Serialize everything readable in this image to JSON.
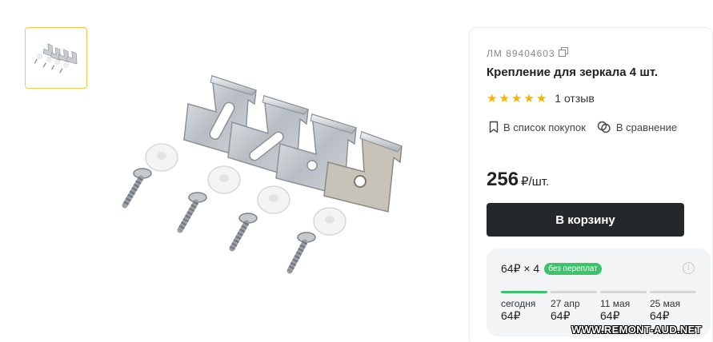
{
  "product": {
    "article": "ЛМ 89404603",
    "title": "Крепление для зеркала 4 шт.",
    "rating": 5,
    "reviews": "1 отзыв",
    "actions": {
      "shopping_list": "В список покупок",
      "compare": "В сравнение"
    },
    "price": "256",
    "price_unit": "₽/шт.",
    "buy_label": "В корзину"
  },
  "installment": {
    "summary": "64₽ × 4",
    "badge": "без переплат",
    "info_icon": "i",
    "steps": [
      {
        "date": "сегодня",
        "amount": "64₽"
      },
      {
        "date": "27 апр",
        "amount": "64₽"
      },
      {
        "date": "11 мая",
        "amount": "64₽"
      },
      {
        "date": "25 мая",
        "amount": "64₽"
      }
    ]
  },
  "watermark": "WWW.REMONT-AUD.NET",
  "colors": {
    "buy_button": "#25282b",
    "badge": "#3cc46b",
    "star": "#f6b600",
    "thumb_border": "#f2c94c"
  },
  "icons": [
    "copy-icon",
    "star-icon",
    "bookmark-icon",
    "compare-icon",
    "info-icon"
  ]
}
